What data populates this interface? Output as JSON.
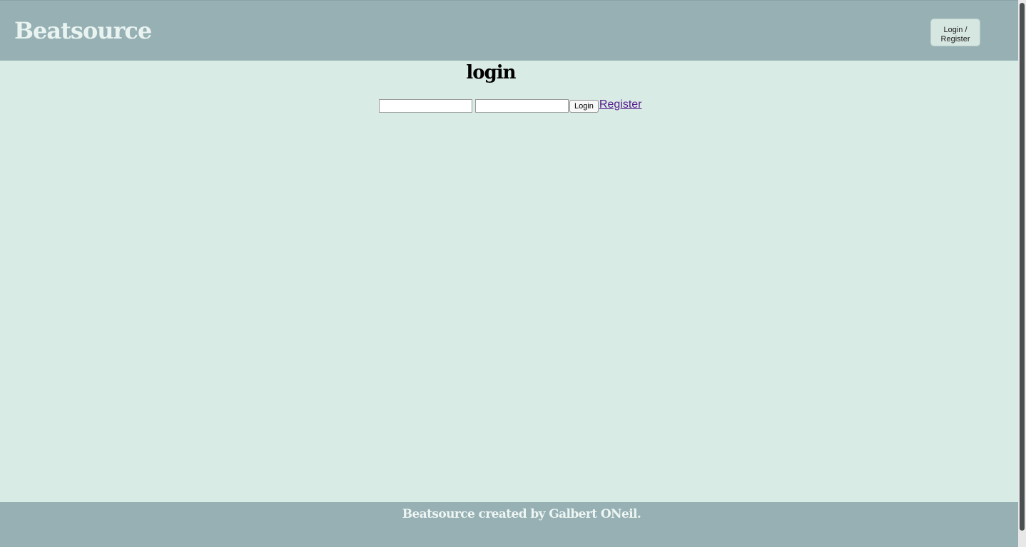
{
  "header": {
    "brand": "Beatsource",
    "auth_button_label": "Login / Register"
  },
  "main": {
    "title": "login",
    "form": {
      "username_value": "",
      "password_value": "",
      "login_label": "Login",
      "register_label": "Register"
    }
  },
  "footer": {
    "text": "Beatsource created by Galbert ONeil."
  },
  "colors": {
    "header_bg": "#96b0b4",
    "page_bg": "#d9ebe5",
    "link": "#551a8b"
  }
}
